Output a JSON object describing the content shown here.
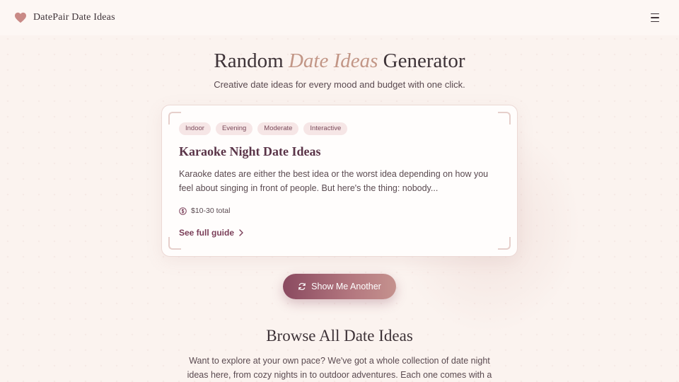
{
  "header": {
    "brand_name": "DatePair Date Ideas",
    "logo_icon": "heart-icon",
    "menu_icon": "hamburger-menu-icon"
  },
  "hero": {
    "title_before": "Random ",
    "title_highlight": "Date Ideas",
    "title_after": " Generator",
    "subtitle": "Creative date ideas for every mood and budget with one click."
  },
  "card": {
    "tags": [
      "Indoor",
      "Evening",
      "Moderate",
      "Interactive"
    ],
    "title": "Karaoke Night Date Ideas",
    "description": "Karaoke dates are either the best idea or the worst idea depending on how you feel about singing in front of people. But here's the thing: nobody...",
    "cost": "$10-30 total",
    "cost_icon": "dollar-circle-icon",
    "guide_label": "See full guide",
    "guide_icon": "chevron-right-icon"
  },
  "action": {
    "button_label": "Show Me Another",
    "button_icon": "refresh-icon"
  },
  "browse": {
    "title": "Browse All Date Ideas",
    "text": "Want to explore at your own pace? We've got a whole collection of date night ideas here, from cozy nights in to outdoor adventures. Each one comes with a full"
  },
  "colors": {
    "accent": "#7a3e58",
    "highlight": "#c29686",
    "background": "#fbf3ef",
    "tag_bg": "#f6e6e6"
  }
}
